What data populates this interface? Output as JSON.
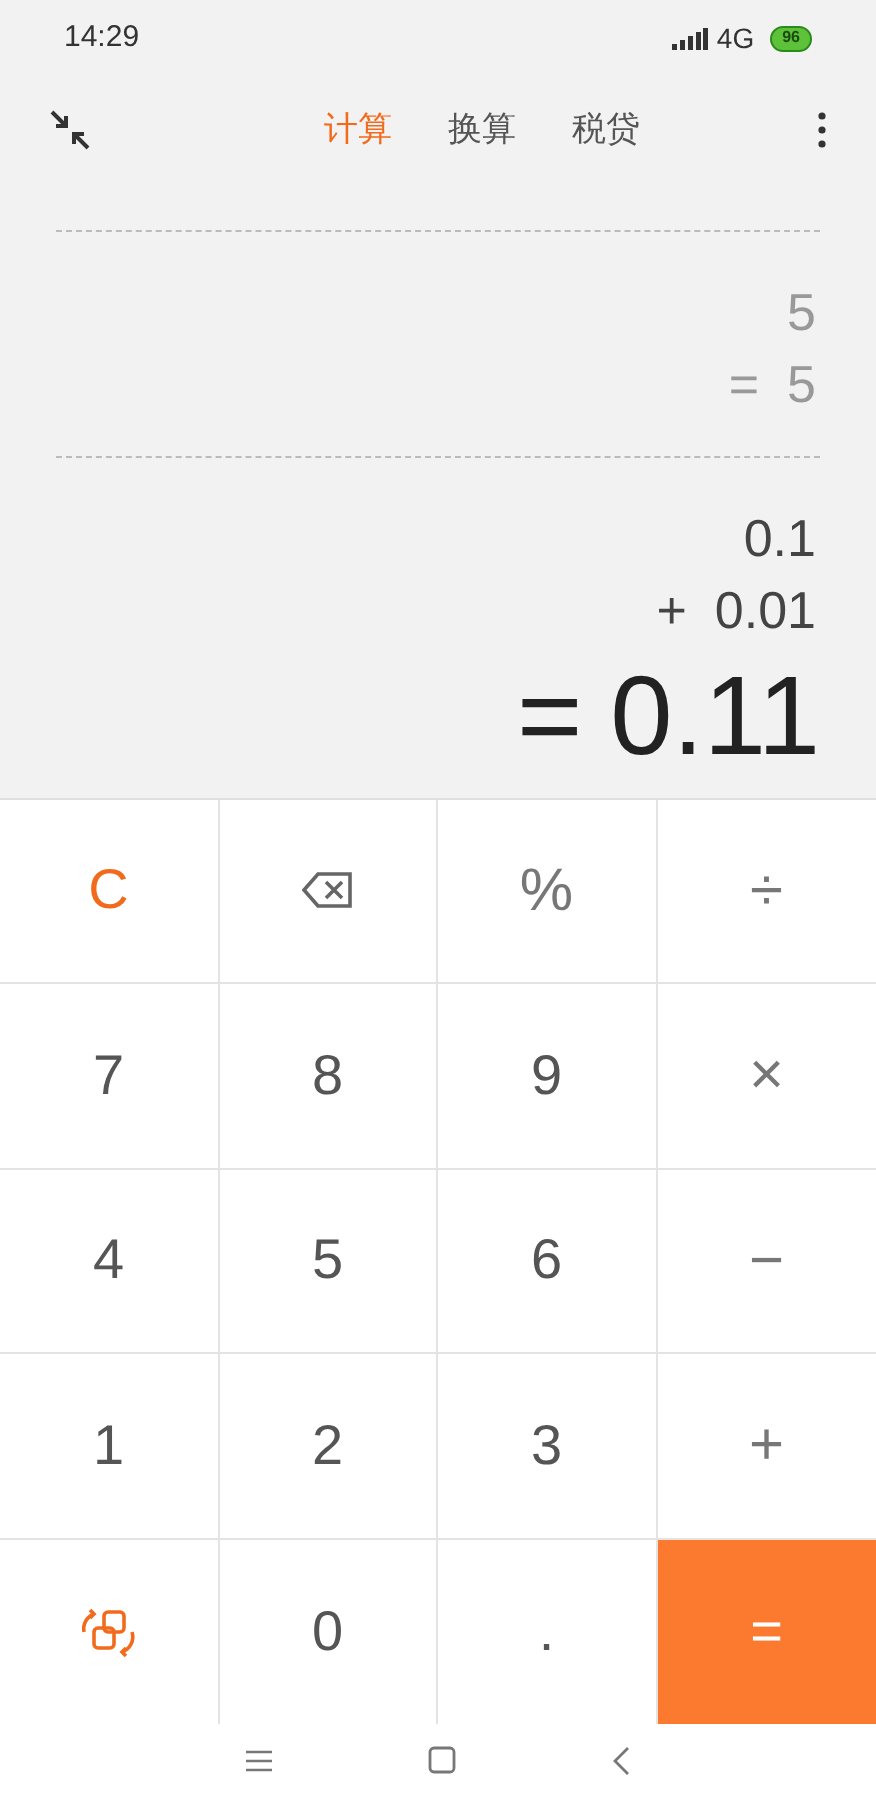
{
  "status_bar": {
    "time": "14:29",
    "network": "4G",
    "battery": "96"
  },
  "header": {
    "tabs": [
      {
        "label": "计算",
        "selected": true
      },
      {
        "label": "换算",
        "selected": false
      },
      {
        "label": "税贷",
        "selected": false
      }
    ]
  },
  "history": [
    {
      "lines": [
        {
          "value": "5"
        },
        {
          "op": "=",
          "value": "5"
        }
      ]
    }
  ],
  "current": {
    "lines": [
      {
        "value": "0.1"
      },
      {
        "op": "+",
        "value": "0.01"
      }
    ],
    "result": {
      "op": "=",
      "value": "0.11"
    }
  },
  "keys": [
    {
      "kind": "clear",
      "label": "C"
    },
    {
      "kind": "backspace"
    },
    {
      "kind": "operator",
      "label": "%"
    },
    {
      "kind": "operator",
      "label": "÷"
    },
    {
      "kind": "digit",
      "label": "7"
    },
    {
      "kind": "digit",
      "label": "8"
    },
    {
      "kind": "digit",
      "label": "9"
    },
    {
      "kind": "operator",
      "label": "×"
    },
    {
      "kind": "digit",
      "label": "4"
    },
    {
      "kind": "digit",
      "label": "5"
    },
    {
      "kind": "digit",
      "label": "6"
    },
    {
      "kind": "operator",
      "label": "−"
    },
    {
      "kind": "digit",
      "label": "1"
    },
    {
      "kind": "digit",
      "label": "2"
    },
    {
      "kind": "digit",
      "label": "3"
    },
    {
      "kind": "operator",
      "label": "+"
    },
    {
      "kind": "swap"
    },
    {
      "kind": "digit",
      "label": "0"
    },
    {
      "kind": "digit",
      "label": "."
    },
    {
      "kind": "equals",
      "label": "="
    }
  ]
}
